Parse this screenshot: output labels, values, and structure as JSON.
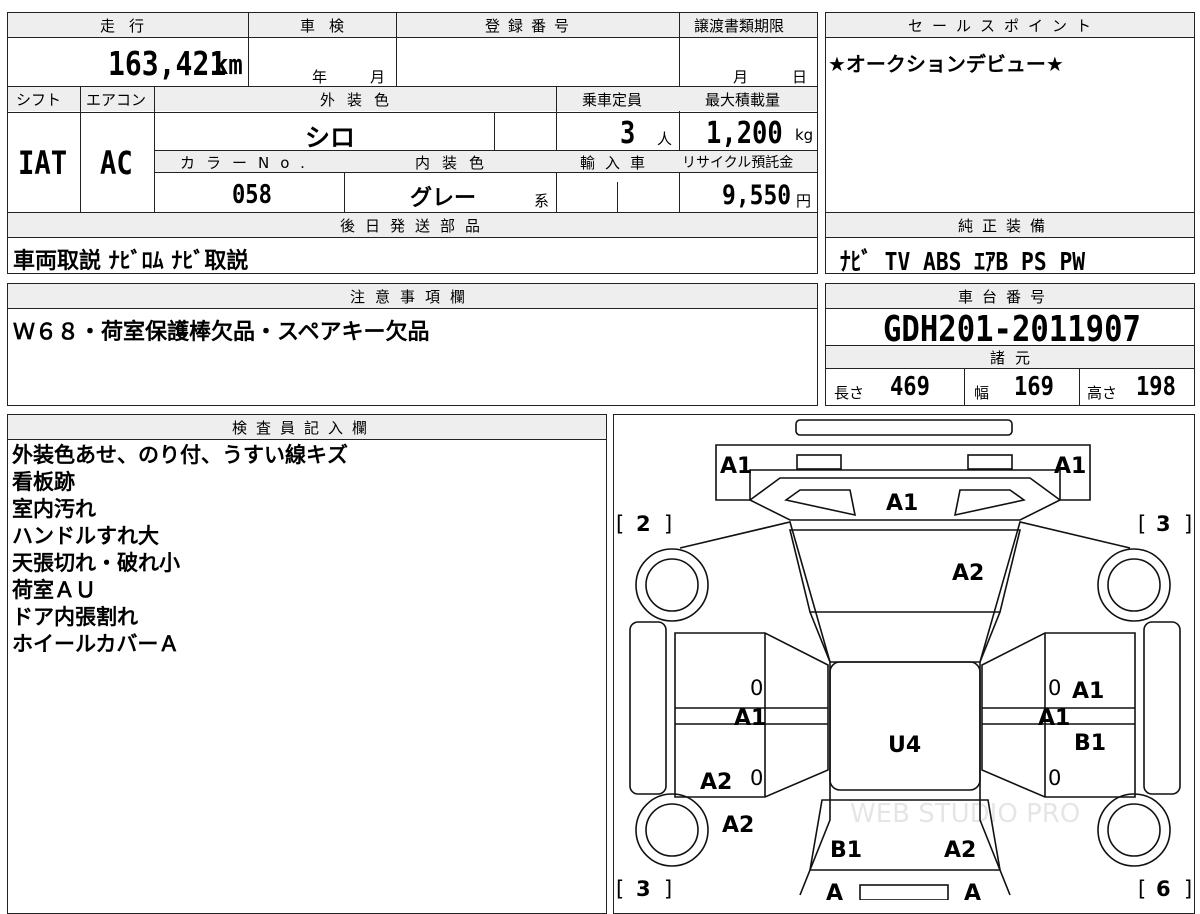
{
  "specs": {
    "mileage_header": "走行",
    "mileage_value": "163,421",
    "mileage_unit": "km",
    "inspection_header": "車検",
    "inspection_year": "年",
    "inspection_month": "月",
    "registration_header": "登録番号",
    "transfer_header": "譲渡書類期限",
    "transfer_month": "月",
    "transfer_day": "日",
    "shift_header": "シフト",
    "shift_value": "IAT",
    "aircon_header": "エアコン",
    "aircon_value": "AC",
    "exterior_color_header": "外装色",
    "exterior_color_value": "シロ",
    "capacity_header": "乗車定員",
    "capacity_value": "3",
    "capacity_unit": "人",
    "max_load_header": "最大積載量",
    "max_load_value": "1,200",
    "max_load_unit": "kg",
    "color_no_header": "カラーNo.",
    "color_no_value": "058",
    "interior_color_header": "内装色",
    "interior_color_value": "グレー",
    "interior_color_suffix": "系",
    "import_header": "輸入車",
    "recycle_header": "リサイクル預託金",
    "recycle_value": "9,550",
    "recycle_unit": "円"
  },
  "sales_points": {
    "header": "セールスポイント",
    "text": "★オークションデビュー★"
  },
  "later_shipping": {
    "header": "後日発送部品",
    "text": "車両取説 ﾅﾋﾞﾛﾑ ﾅﾋﾞ取説"
  },
  "genuine_equipment": {
    "header": "純正装備",
    "text": "ﾅﾋﾞ TV ABS ｴｱB PS PW"
  },
  "notes": {
    "header": "注意事項欄",
    "text": "Ｗ６８・荷室保護棒欠品・スペアキー欠品"
  },
  "chassis": {
    "header": "車台番号",
    "value": "GDH201-2011907",
    "dims_header": "諸元",
    "length_label": "長さ",
    "length_value": "469",
    "width_label": "幅",
    "width_value": "169",
    "height_label": "高さ",
    "height_value": "198"
  },
  "inspector": {
    "header": "検査員記入欄",
    "lines": [
      "外装色あせ、のり付、うすい線キズ",
      "看板跡",
      "室内汚れ",
      "ハンドルすれ大",
      "天張切れ・破れ小",
      "荷室ＡＵ",
      "ドア内張割れ",
      "ホイールカバーＡ"
    ]
  },
  "diagram": {
    "marks": {
      "front_left": "A1",
      "front_right": "A1",
      "hood": "A1",
      "windshield": "A2",
      "left_front_door": "A1",
      "right_front_door_top": "A1",
      "right_front_door": "A1",
      "right_rear_door": "B1",
      "roof": "U4",
      "left_rear_door": "A2",
      "left_rear_quarter": "A2",
      "rear_left": "B1",
      "rear_right": "A2",
      "rear_bumper_left": "A",
      "rear_bumper_right": "A"
    },
    "zeros": [
      "0",
      "0",
      "0",
      "0"
    ],
    "tires": {
      "front_left": "2",
      "front_right": "3",
      "rear_left": "3",
      "rear_right": "6"
    },
    "watermark": "WEB STUDIO PRO"
  }
}
